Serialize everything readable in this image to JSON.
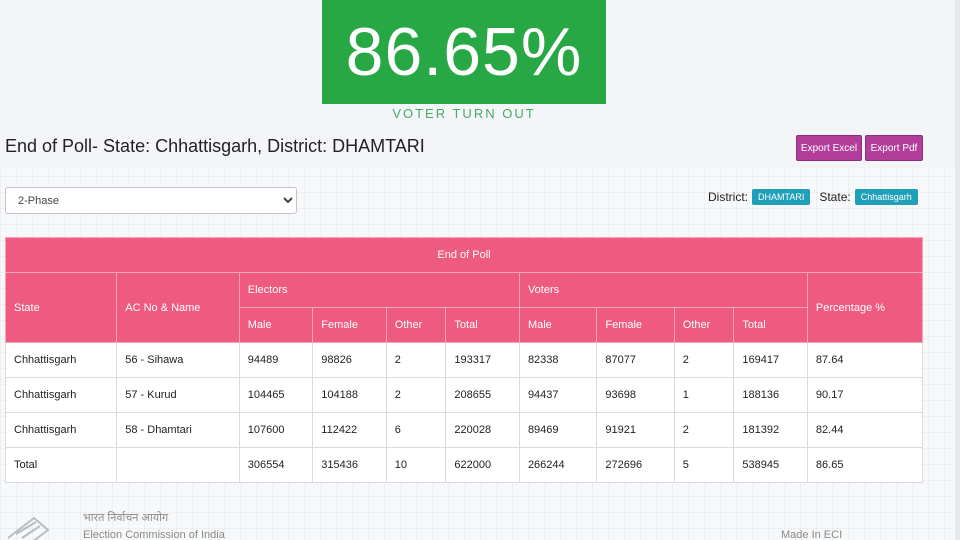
{
  "turnout": {
    "value": "86.65%",
    "label": "VOTER TURN OUT"
  },
  "header": {
    "title": "End of Poll- State: Chhattisgarh, District: DHAMTARI",
    "export_excel": "Export Excel",
    "export_pdf": "Export Pdf"
  },
  "filters": {
    "phase_selected": "2-Phase",
    "district_label": "District:",
    "district_value": "DHAMTARI",
    "state_label": "State:",
    "state_value": "Chhattisgarh"
  },
  "table": {
    "caption": "End of Poll",
    "col_state": "State",
    "col_ac": "AC No & Name",
    "group_electors": "Electors",
    "group_voters": "Voters",
    "col_percentage": "Percentage %",
    "sub_male": "Male",
    "sub_female": "Female",
    "sub_other": "Other",
    "sub_total": "Total",
    "rows": [
      [
        "Chhattisgarh",
        "56 - Sihawa",
        "94489",
        "98826",
        "2",
        "193317",
        "82338",
        "87077",
        "2",
        "169417",
        "87.64"
      ],
      [
        "Chhattisgarh",
        "57 - Kurud",
        "104465",
        "104188",
        "2",
        "208655",
        "94437",
        "93698",
        "1",
        "188136",
        "90.17"
      ],
      [
        "Chhattisgarh",
        "58 - Dhamtari",
        "107600",
        "112422",
        "6",
        "220028",
        "89469",
        "91921",
        "2",
        "181392",
        "82.44"
      ],
      [
        "Total",
        "",
        "306554",
        "315436",
        "10",
        "622000",
        "266244",
        "272696",
        "5",
        "538945",
        "86.65"
      ]
    ]
  },
  "footer": {
    "hindi": "भारत निर्वाचन आयोग",
    "english": "Election Commission of India",
    "made_in": "Made In ECI"
  }
}
